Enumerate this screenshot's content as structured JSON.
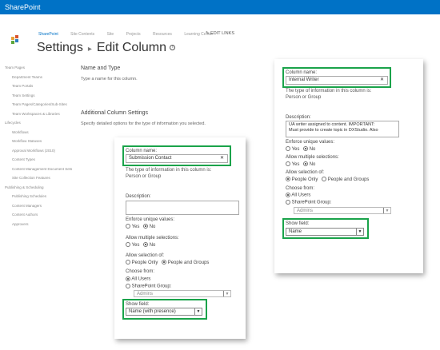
{
  "suite_bar": {
    "brand": "SharePoint"
  },
  "top_nav": {
    "items": [
      "SharePoint",
      "Site Contents",
      "Site",
      "Projects",
      "Resources",
      "Learning Center"
    ],
    "edit_links": "EDIT LINKS"
  },
  "page": {
    "title": "Settings",
    "subtitle": "Edit Column",
    "info_icon": "info-icon"
  },
  "quick_launch": [
    {
      "label": "Team Pages",
      "sub": false
    },
    {
      "label": "Department Teams",
      "sub": true
    },
    {
      "label": "Team Portals",
      "sub": true
    },
    {
      "label": "Team Settings",
      "sub": true
    },
    {
      "label": "Team Pages/Categories/Sub-Sites",
      "sub": true
    },
    {
      "label": "Team Workspaces & Libraries",
      "sub": true
    },
    {
      "label": "Lifecycles",
      "sub": false
    },
    {
      "label": "Workflows",
      "sub": true
    },
    {
      "label": "Workflow Statuses",
      "sub": true
    },
    {
      "label": "Approval Workflows (2010)",
      "sub": true
    },
    {
      "label": "Content Types",
      "sub": true
    },
    {
      "label": "Content Management Document Sets",
      "sub": true
    },
    {
      "label": "Site Collection Features",
      "sub": true
    },
    {
      "label": "Publishing & Scheduling",
      "sub": false
    },
    {
      "label": "Publishing Schedules",
      "sub": true
    },
    {
      "label": "Content Managers",
      "sub": true
    },
    {
      "label": "Content Authors",
      "sub": true
    },
    {
      "label": "Approvers",
      "sub": true
    }
  ],
  "sections": {
    "name_type": {
      "heading": "Name and Type",
      "desc": "Type a name for this column."
    },
    "additional": {
      "heading": "Additional Column Settings",
      "desc": "Specify detailed options for the type of information you selected."
    }
  },
  "right_panel": {
    "column_name_label": "Column name:",
    "column_name_value": "Internal Writer",
    "type_label": "The type of information in this column is:",
    "type_value": "Person or Group",
    "description_label": "Description:",
    "description_lines": [
      "UA writer assigned to content. IMPORTANT:",
      "Must provide to create topic in DXStudio. Also"
    ],
    "enforce_label": "Enforce unique values:",
    "yes": "Yes",
    "no": "No",
    "multiple_label": "Allow multiple selections:",
    "selection_label": "Allow selection of:",
    "people_only": "People Only",
    "people_groups": "People and Groups",
    "choose_label": "Choose from:",
    "all_users": "All Users",
    "sp_group": "SharePoint Group:",
    "group_value": "Admins",
    "show_field_label": "Show field:",
    "show_field_value": "Name"
  },
  "left_panel": {
    "column_name_label": "Column name:",
    "column_name_value": "Submission Contact",
    "type_label": "The type of information in this column is:",
    "type_value": "Person or Group",
    "description_label": "Description:",
    "enforce_label": "Enforce unique values:",
    "yes": "Yes",
    "no": "No",
    "multiple_label": "Allow multiple selections:",
    "selection_label": "Allow selection of:",
    "people_only": "People Only",
    "people_groups": "People and Groups",
    "choose_label": "Choose from:",
    "all_users": "All Users",
    "sp_group": "SharePoint Group:",
    "group_value": "Admins",
    "show_field_label": "Show field:",
    "show_field_value": "Name (with presence)"
  },
  "colors": {
    "suite_bar": "#0072c6",
    "highlight": "#1aa34a"
  }
}
